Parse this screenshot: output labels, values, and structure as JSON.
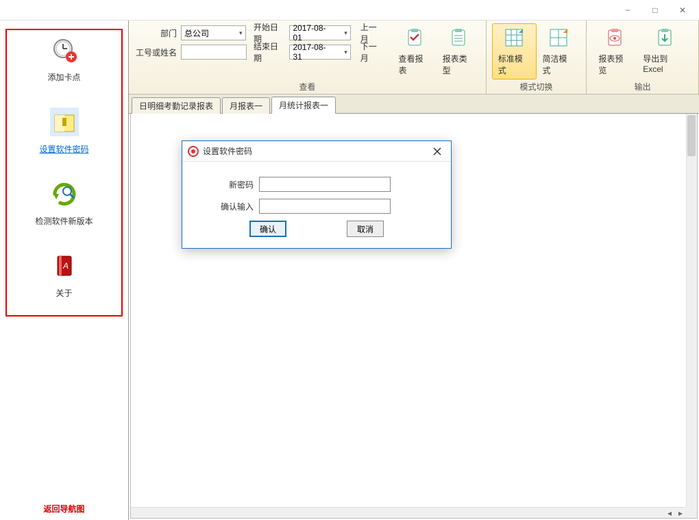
{
  "window": {
    "minimize_icon": "−",
    "maximize_icon": "□",
    "close_icon": "✕"
  },
  "ribbon": {
    "dept_label": "部门",
    "dept_value": "总公司",
    "idname_label": "工号或姓名",
    "idname_value": "",
    "start_date_label": "开始日期",
    "start_date_value": "2017-08-01",
    "end_date_label": "结束日期",
    "end_date_value": "2017-08-31",
    "prev_month": "上一月",
    "next_month": "下一月",
    "view_report": "查看报表",
    "report_type": "报表类型",
    "group_view": "查看",
    "std_mode": "标准模式",
    "simple_mode": "简洁模式",
    "group_mode": "模式切换",
    "preview": "报表预览",
    "export_excel": "导出到Excel",
    "group_output": "输出"
  },
  "sidebar": {
    "items": [
      {
        "label": "添加卡点"
      },
      {
        "label": "设置软件密码"
      },
      {
        "label": "检测软件新版本"
      },
      {
        "label": "关于"
      }
    ],
    "footer": "返回导航图"
  },
  "tabs": [
    {
      "label": "日明细考勤记录报表"
    },
    {
      "label": "月报表一"
    },
    {
      "label": "月统计报表一"
    }
  ],
  "dialog": {
    "title": "设置软件密码",
    "new_pwd_label": "新密码",
    "confirm_label": "确认输入",
    "ok": "确认",
    "cancel": "取消"
  }
}
